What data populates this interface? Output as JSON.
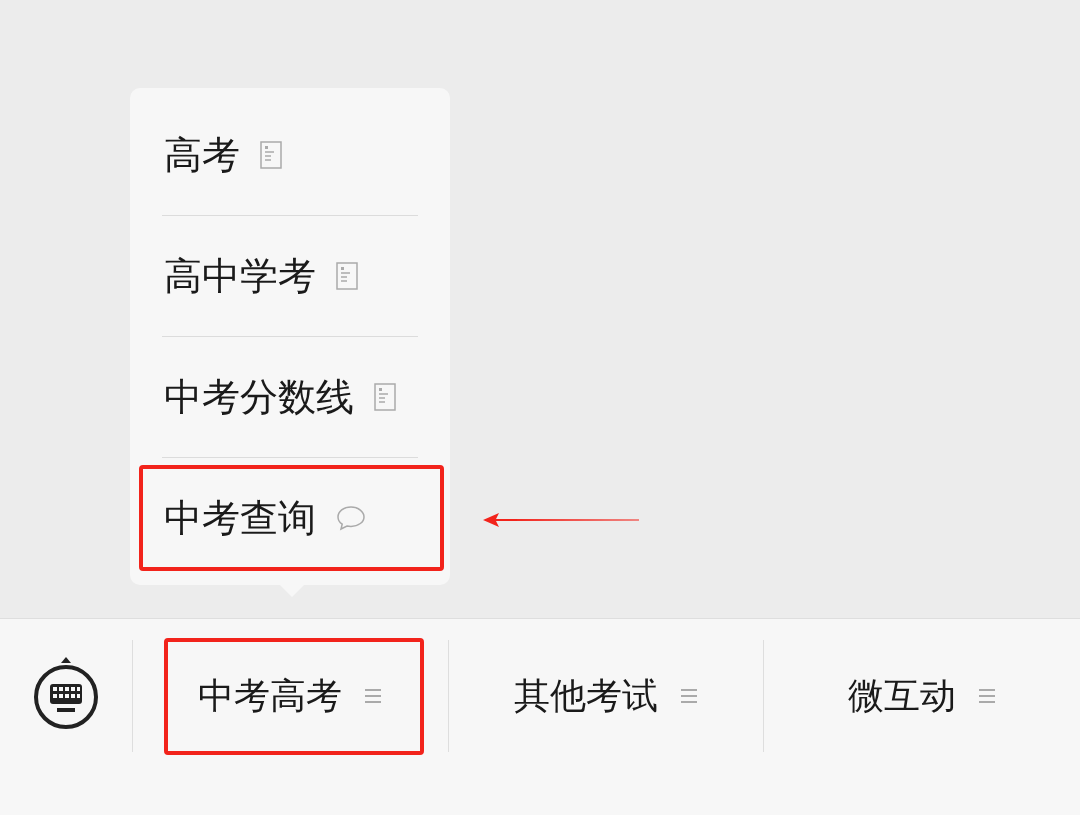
{
  "popup_menu": {
    "items": [
      {
        "label": "高考",
        "kind": "page",
        "highlighted": false,
        "arrow": false
      },
      {
        "label": "高中学考",
        "kind": "page",
        "highlighted": false,
        "arrow": false
      },
      {
        "label": "中考分数线",
        "kind": "page",
        "highlighted": false,
        "arrow": false
      },
      {
        "label": "中考查询",
        "kind": "chat",
        "highlighted": true,
        "arrow": true
      }
    ]
  },
  "menu_bar": {
    "tabs": [
      {
        "label": "中考高考",
        "highlighted": true
      },
      {
        "label": "其他考试",
        "highlighted": false
      },
      {
        "label": "微互动",
        "highlighted": false
      }
    ]
  }
}
